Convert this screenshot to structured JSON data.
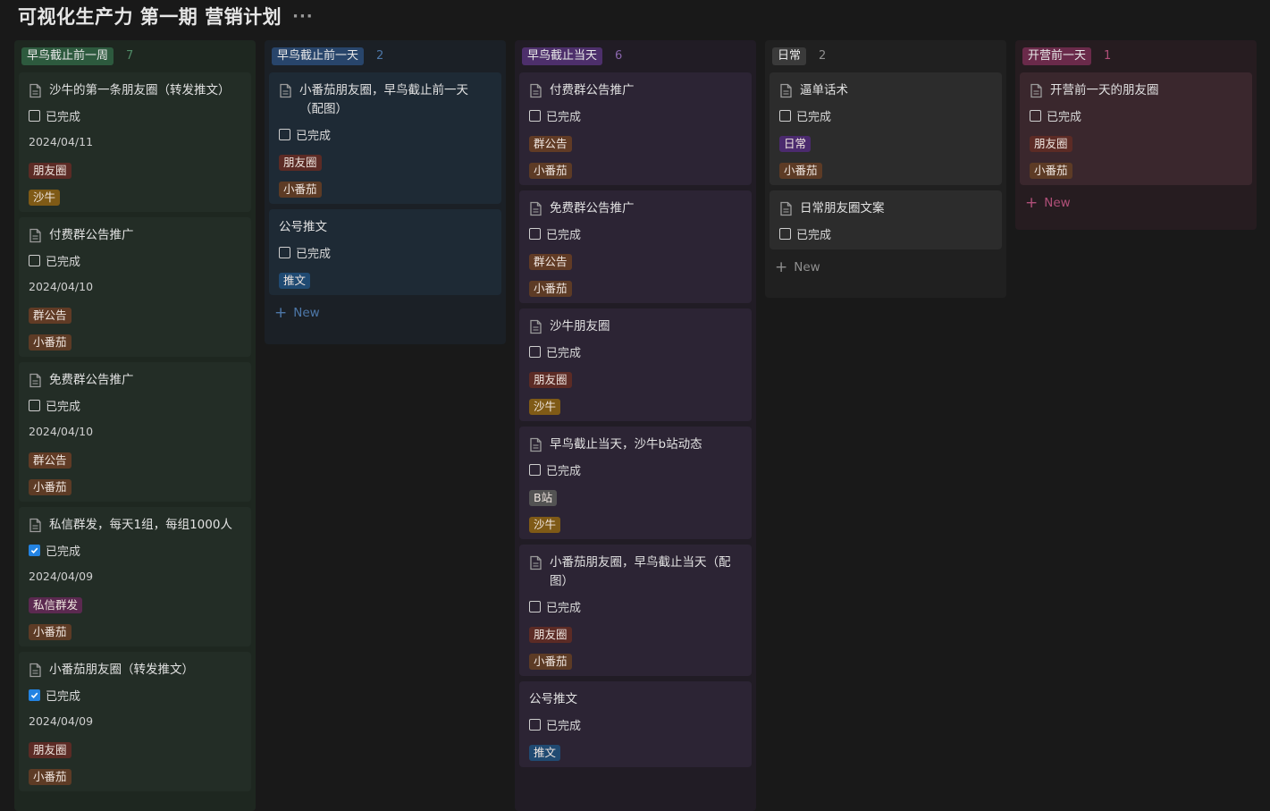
{
  "page": {
    "title": "可视化生产力 第一期 营销计划",
    "more_label": "···"
  },
  "tag_colors": {
    "朋友圈": "#5c2b25",
    "沙牛": "#7f5a16",
    "群公告": "#613b25",
    "小番茄": "#5d3b25",
    "私信群发": "#5b2950",
    "推文": "#204a72",
    "日常": "#4b2a6e",
    "B站": "#535353"
  },
  "columns": [
    {
      "label": "早鸟截止前一周",
      "count": "7",
      "tag_bg": "#2d5a3e",
      "count_color": "#4f8a66",
      "col_bg": "#1e2720",
      "card_bg": "#232d26",
      "new_label": "",
      "cards": [
        {
          "icon": "document-icon",
          "title": "沙牛的第一条朋友圈（转发推文）",
          "check_label": "已完成",
          "checked": false,
          "date": "2024/04/11",
          "tags": [
            "朋友圈",
            "沙牛"
          ]
        },
        {
          "icon": "document-icon",
          "title": "付费群公告推广",
          "check_label": "已完成",
          "checked": false,
          "date": "2024/04/10",
          "tags": [
            "群公告",
            "小番茄"
          ]
        },
        {
          "icon": "document-icon",
          "title": "免费群公告推广",
          "check_label": "已完成",
          "checked": false,
          "date": "2024/04/10",
          "tags": [
            "群公告",
            "小番茄"
          ]
        },
        {
          "icon": "document-icon",
          "title": "私信群发，每天1组，每组1000人",
          "check_label": "已完成",
          "checked": true,
          "date": "2024/04/09",
          "tags": [
            "私信群发",
            "小番茄"
          ]
        },
        {
          "icon": "document-icon",
          "title": "小番茄朋友圈（转发推文）",
          "check_label": "已完成",
          "checked": true,
          "date": "2024/04/09",
          "tags": [
            "朋友圈",
            "小番茄"
          ]
        }
      ]
    },
    {
      "label": "早鸟截止前一天",
      "count": "2",
      "tag_bg": "#28456b",
      "count_color": "#4d77a8",
      "col_bg": "#1b2026",
      "card_bg": "#1e2a35",
      "new_label": "New",
      "new_color": "#4d77a8",
      "cards": [
        {
          "icon": "document-icon",
          "title": "小番茄朋友圈，早鸟截止前一天（配图）",
          "check_label": "已完成",
          "checked": false,
          "date": "",
          "tags": [
            "朋友圈",
            "小番茄"
          ]
        },
        {
          "icon": "",
          "title": "公号推文",
          "check_label": "已完成",
          "checked": false,
          "date": "",
          "tags": [
            "推文"
          ]
        }
      ]
    },
    {
      "label": "早鸟截止当天",
      "count": "6",
      "tag_bg": "#4d2f6b",
      "count_color": "#8a66ad",
      "col_bg": "#211c25",
      "card_bg": "#2c2434",
      "new_label": "",
      "cards": [
        {
          "icon": "document-icon",
          "title": "付费群公告推广",
          "check_label": "已完成",
          "checked": false,
          "date": "",
          "tags": [
            "群公告",
            "小番茄"
          ]
        },
        {
          "icon": "document-icon",
          "title": "免费群公告推广",
          "check_label": "已完成",
          "checked": false,
          "date": "",
          "tags": [
            "群公告",
            "小番茄"
          ]
        },
        {
          "icon": "document-icon",
          "title": "沙牛朋友圈",
          "check_label": "已完成",
          "checked": false,
          "date": "",
          "tags": [
            "朋友圈",
            "沙牛"
          ]
        },
        {
          "icon": "document-icon",
          "title": "早鸟截止当天，沙牛b站动态",
          "check_label": "已完成",
          "checked": false,
          "date": "",
          "tags": [
            "B站",
            "沙牛"
          ]
        },
        {
          "icon": "document-icon",
          "title": "小番茄朋友圈，早鸟截止当天（配图）",
          "check_label": "已完成",
          "checked": false,
          "date": "",
          "tags": [
            "朋友圈",
            "小番茄"
          ]
        },
        {
          "icon": "",
          "title": "公号推文",
          "check_label": "已完成",
          "checked": false,
          "date": "",
          "tags": [
            "推文"
          ]
        }
      ]
    },
    {
      "label": "日常",
      "count": "2",
      "tag_bg": "#3a3a3a",
      "count_color": "#8f8f8f",
      "col_bg": "#202020",
      "card_bg": "#2c2c2c",
      "new_label": "New",
      "new_color": "#8f8f8f",
      "cards": [
        {
          "icon": "document-icon",
          "title": "逼单话术",
          "check_label": "已完成",
          "checked": false,
          "date": "",
          "tags": [
            "日常",
            "小番茄"
          ]
        },
        {
          "icon": "document-icon",
          "title": "日常朋友圈文案",
          "check_label": "已完成",
          "checked": false,
          "date": "",
          "tags": []
        }
      ]
    },
    {
      "label": "开营前一天",
      "count": "1",
      "tag_bg": "#6a2a4a",
      "count_color": "#b04f78",
      "col_bg": "#261c20",
      "card_bg": "#3a272d",
      "new_label": "New",
      "new_color": "#b04f78",
      "cards": [
        {
          "icon": "document-icon",
          "title": "开营前一天的朋友圈",
          "check_label": "已完成",
          "checked": false,
          "date": "",
          "tags": [
            "朋友圈",
            "小番茄"
          ]
        }
      ]
    }
  ]
}
